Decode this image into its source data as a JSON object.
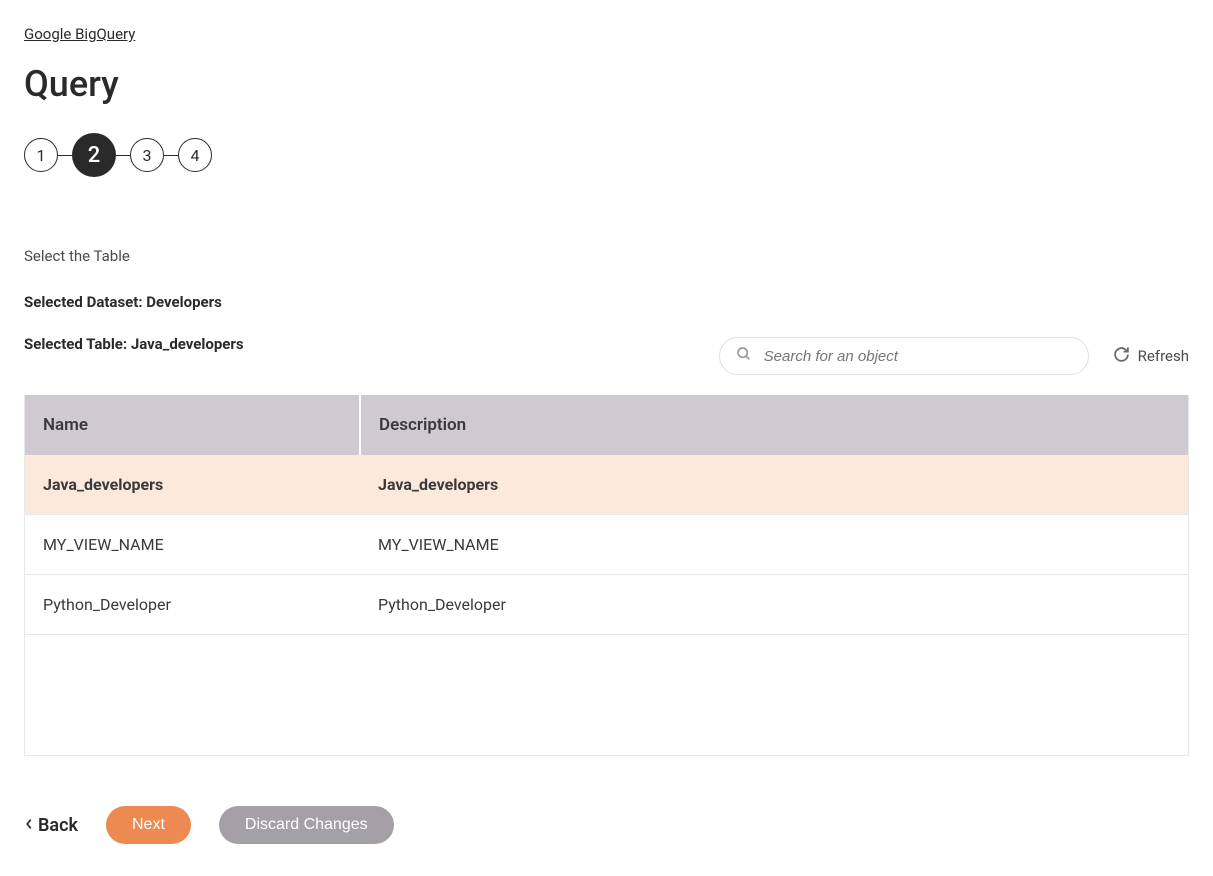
{
  "breadcrumb": {
    "label": "Google BigQuery"
  },
  "page_title": "Query",
  "stepper": {
    "steps": [
      "1",
      "2",
      "3",
      "4"
    ],
    "active_index": 1
  },
  "section_label": "Select the Table",
  "selected_dataset_line": "Selected Dataset: Developers",
  "selected_table_line": "Selected Table: Java_developers",
  "search": {
    "placeholder": "Search for an object"
  },
  "refresh_label": "Refresh",
  "table": {
    "headers": {
      "name": "Name",
      "description": "Description"
    },
    "rows": [
      {
        "name": "Java_developers",
        "description": "Java_developers",
        "selected": true
      },
      {
        "name": "MY_VIEW_NAME",
        "description": "MY_VIEW_NAME",
        "selected": false
      },
      {
        "name": "Python_Developer",
        "description": "Python_Developer",
        "selected": false
      }
    ]
  },
  "actions": {
    "back": "Back",
    "next": "Next",
    "discard": "Discard Changes"
  }
}
